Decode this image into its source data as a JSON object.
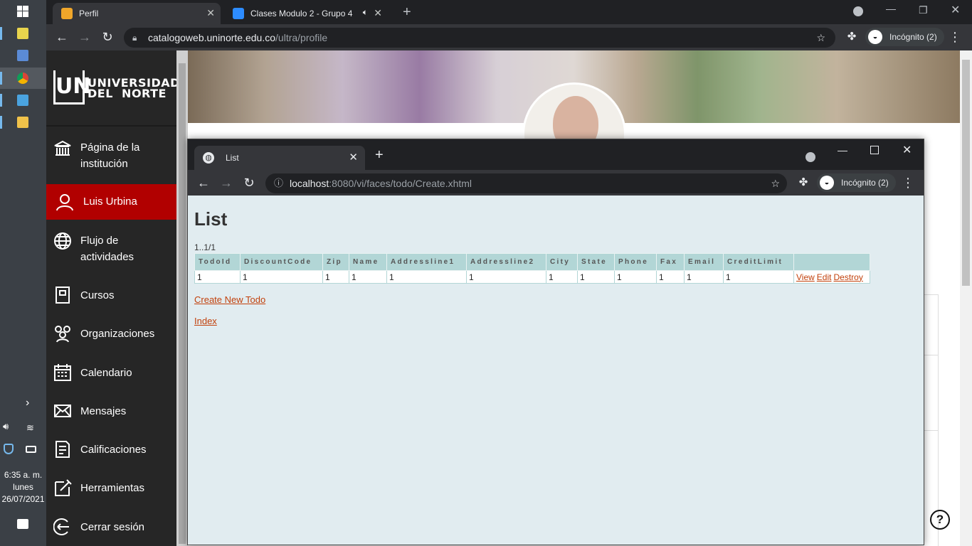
{
  "outer_browser": {
    "tabs": [
      {
        "title": "Perfil",
        "active": true
      },
      {
        "title": "Clases Modulo 2 - Grupo 4",
        "active": false
      }
    ],
    "url_host": "catalogoweb.uninorte.edu.co",
    "url_path": "/ultra/profile",
    "incognito_label": "Incógnito (2)"
  },
  "taskbar": {
    "time": "6:35 a. m.",
    "day": "lunes",
    "date": "26/07/2021"
  },
  "sidebar": {
    "logo_line1": "UNIVERSIDAD",
    "logo_line2": "DEL  NORTE",
    "items": [
      {
        "label": "Página de la institución",
        "icon": "institution-icon"
      },
      {
        "label": "Luis Urbina",
        "icon": "user-icon",
        "active": true
      },
      {
        "label": "Flujo de actividades",
        "icon": "globe-icon"
      },
      {
        "label": "Cursos",
        "icon": "book-icon"
      },
      {
        "label": "Organizaciones",
        "icon": "people-icon"
      },
      {
        "label": "Calendario",
        "icon": "calendar-icon"
      },
      {
        "label": "Mensajes",
        "icon": "envelope-icon"
      },
      {
        "label": "Calificaciones",
        "icon": "gradebook-icon"
      },
      {
        "label": "Herramientas",
        "icon": "tools-icon"
      },
      {
        "label": "Cerrar sesión",
        "icon": "logout-icon"
      }
    ]
  },
  "popup": {
    "tab_title": "List",
    "url_host": "localhost",
    "url_path": ":8080/vi/faces/todo/Create.xhtml",
    "incognito_label": "Incógnito (2)",
    "heading": "List",
    "pager": "1..1/1",
    "table": {
      "columns": [
        "TodoId",
        "DiscountCode",
        "Zip",
        "Name",
        "Addressline1",
        "Addressline2",
        "City",
        "State",
        "Phone",
        "Fax",
        "Email",
        "CreditLimit",
        ""
      ],
      "rows": [
        {
          "cells": [
            "1",
            "1",
            "1",
            "1",
            "1",
            "1",
            "1",
            "1",
            "1",
            "1",
            "1",
            "1"
          ],
          "actions": [
            "View",
            "Edit",
            "Destroy"
          ]
        }
      ]
    },
    "create_link": "Create New Todo",
    "index_link": "Index"
  },
  "colors": {
    "accent_red": "#b10000",
    "link": "#c2410c",
    "table_header": "#b2d6d6",
    "page_bg": "#e1ecf0",
    "assistant_purple": "#6a1b77"
  }
}
